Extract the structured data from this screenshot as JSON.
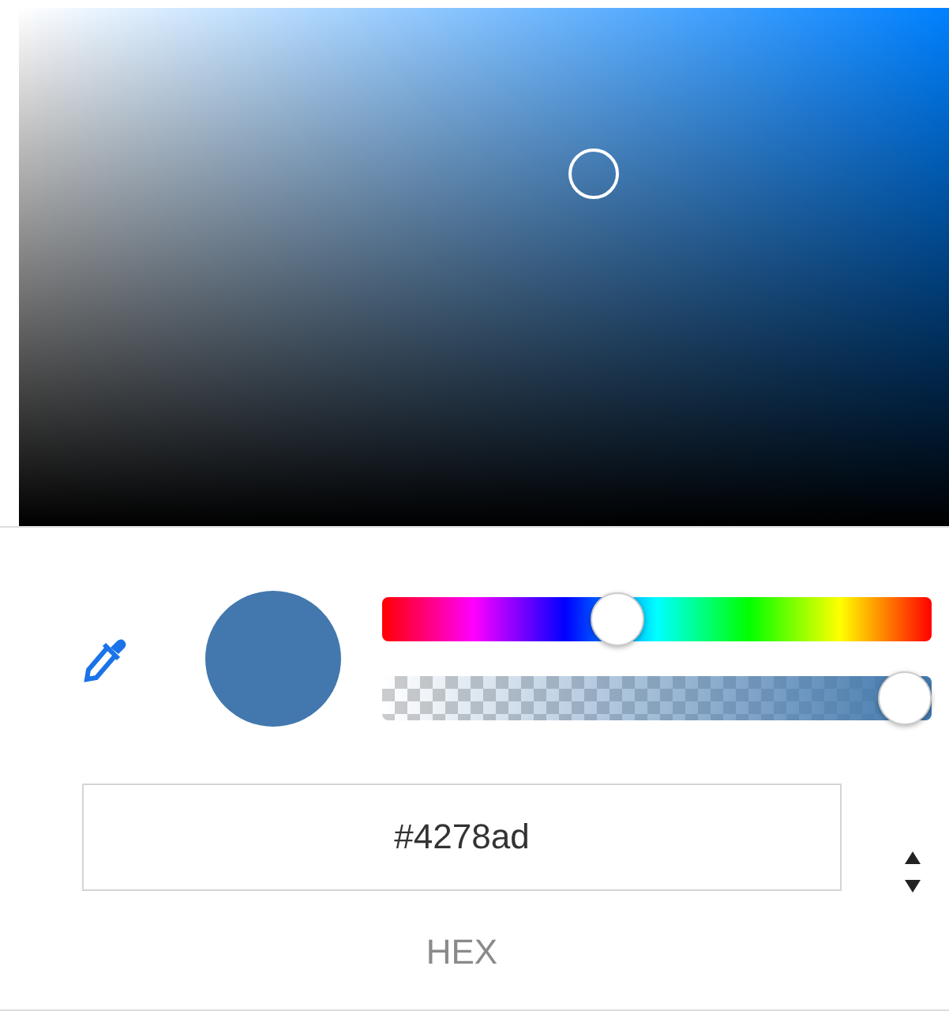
{
  "hue_slider": {
    "level": 0.42
  },
  "alpha_slider": {
    "level": 1
  },
  "color_field": {
    "value": "#4278ad",
    "label": "HEX"
  }
}
